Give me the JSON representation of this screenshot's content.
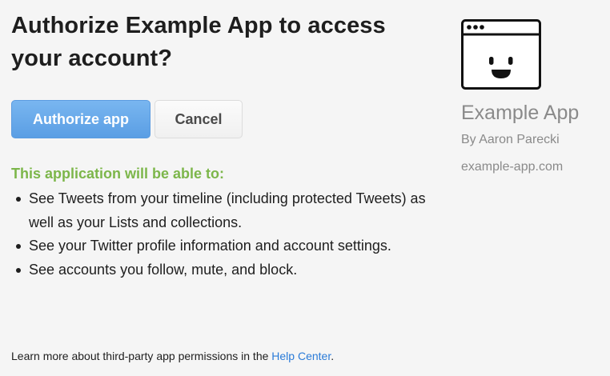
{
  "header": {
    "title": "Authorize Example App to access your account?"
  },
  "buttons": {
    "authorize_label": "Authorize app",
    "cancel_label": "Cancel"
  },
  "permissions": {
    "heading": "This application will be able to:",
    "items": [
      "See Tweets from your timeline (including protected Tweets) as well as your Lists and collections.",
      "See your Twitter profile information and account settings.",
      "See accounts you follow, mute, and block."
    ]
  },
  "footer": {
    "text": "Learn more about third-party app permissions in the ",
    "link": "Help Center",
    "suffix": "."
  },
  "app": {
    "icon": "smiling-browser-window-icon",
    "name": "Example App",
    "author": "By Aaron Parecki",
    "url": "example-app.com"
  },
  "colors": {
    "primary_button": "#5a9ee4",
    "permission_heading": "#7cb64a",
    "link": "#2a7bd8",
    "muted_text": "#8a8a8a",
    "background": "#f5f5f5"
  }
}
